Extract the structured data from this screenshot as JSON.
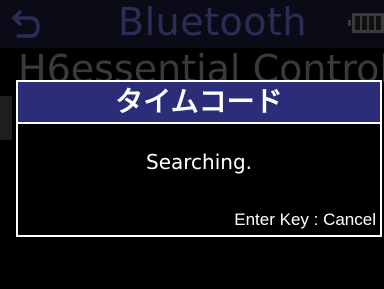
{
  "background": {
    "header": {
      "title": "Bluetooth",
      "back_icon": "back-arrow-icon",
      "battery_icon": "battery-icon"
    },
    "list_item": "H6essential Control"
  },
  "dialog": {
    "title": "タイムコード",
    "message": "Searching.",
    "hint": "Enter Key : Cancel"
  },
  "colors": {
    "title_bar": "#2b2d78",
    "background": "#000000",
    "text": "#ffffff",
    "dim_title": "#2a2d55"
  }
}
